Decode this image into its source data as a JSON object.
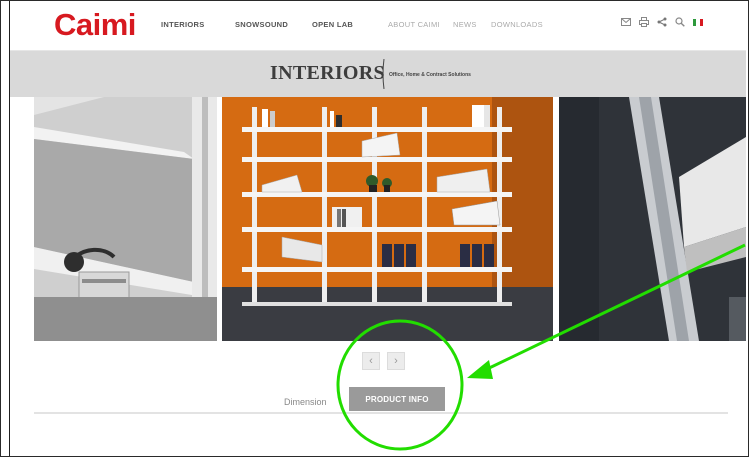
{
  "header": {
    "logo": "Caimi",
    "nav": [
      "INTERIORS",
      "SNOWSOUND",
      "OPEN LAB",
      "ABOUT CAIMI",
      "NEWS",
      "DOWNLOADS"
    ],
    "tools": {
      "mail_icon": "envelope-icon",
      "print_icon": "printer-icon",
      "share_icon": "share-icon",
      "search_icon": "search-icon",
      "language_icon": "italian-flag-icon"
    }
  },
  "band": {
    "title": "INTERIORS",
    "subtitle": "Office, Home & Contract Solutions"
  },
  "carousel": {
    "prev_label": "‹",
    "next_label": "›"
  },
  "tabs": {
    "dimensions_label": "Dimension",
    "product_info_label": "PRODUCT INFO"
  },
  "colors": {
    "brand_red": "#d71920",
    "annotation_green": "#22dd00",
    "tab_grey": "#9a9a9a",
    "band_grey": "#d9d9d9",
    "wall_orange": "#d36a12"
  }
}
